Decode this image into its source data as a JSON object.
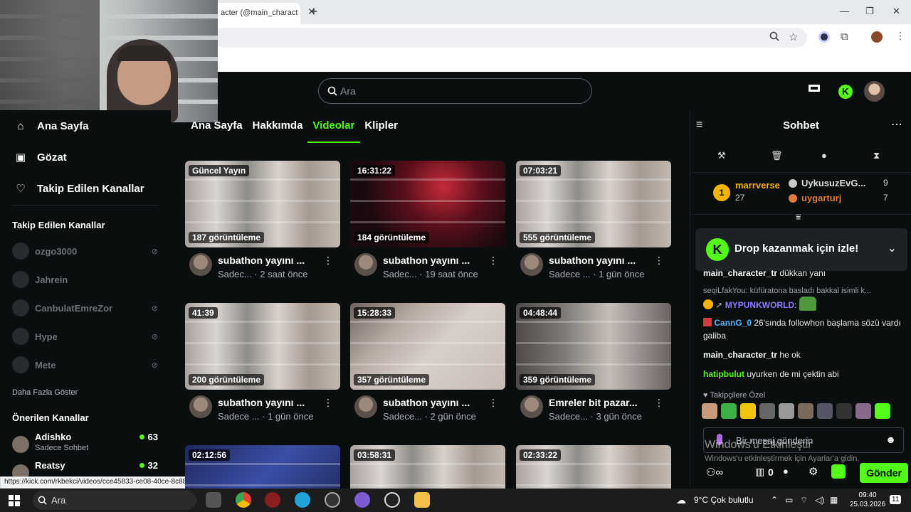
{
  "browser": {
    "tab_title": "acter (@main_charact",
    "status_url": "https://kick.com/rkbekci/videos/cce45833-ce08-40ce-8c88-fb3f95a21946"
  },
  "header": {
    "search_placeholder": "Ara"
  },
  "sidebar": {
    "nav": [
      {
        "label": "Ana Sayfa",
        "icon": "home-icon"
      },
      {
        "label": "Gözat",
        "icon": "browse-icon"
      },
      {
        "label": "Takip Edilen Kanallar",
        "icon": "heart-icon"
      }
    ],
    "followed_title": "Takip Edilen Kanallar",
    "followed": [
      {
        "name": "ozgo3000"
      },
      {
        "name": "Jahrein"
      },
      {
        "name": "CanbulatEmreZor"
      },
      {
        "name": "Hype"
      },
      {
        "name": "Mete"
      }
    ],
    "show_more": "Daha Fazla Göster",
    "recommended_title": "Önerilen Kanallar",
    "recommended": [
      {
        "name": "Adishko",
        "sub": "Sadece Sohbet",
        "viewers": "63"
      },
      {
        "name": "Reatsy",
        "sub": "",
        "viewers": "32"
      }
    ]
  },
  "channel_tabs": [
    "Ana Sayfa",
    "Hakkımda",
    "Videolar",
    "Klipler"
  ],
  "videos": [
    {
      "badge": "Güncel Yayın",
      "views": "187 görüntüleme",
      "title": "subathon yayını ...",
      "sub": "Sadec... · 2 saat önce",
      "style": "thumb-shop"
    },
    {
      "badge": "16:31:22",
      "views": "184 görüntüleme",
      "title": "subathon yayını ...",
      "sub": "Sadec... · 19 saat önce",
      "style": "thumb-dark"
    },
    {
      "badge": "07:03:21",
      "views": "555 görüntüleme",
      "title": "subathon yayını ...",
      "sub": "Sadece ... · 1 gün önce",
      "style": "thumb-shop"
    },
    {
      "badge": "41:39",
      "views": "200 görüntüleme",
      "title": "subathon yayını ...",
      "sub": "Sadece ... · 1 gün önce",
      "style": "thumb-shop"
    },
    {
      "badge": "15:28:33",
      "views": "357 görüntüleme",
      "title": "subathon yayını ...",
      "sub": "Sadece... · 2 gün önce",
      "style": "thumb-wall"
    },
    {
      "badge": "04:48:44",
      "views": "359 görüntüleme",
      "title": "Emreler bit pazar...",
      "sub": "Sadece... · 3 gün önce",
      "style": "thumb-desk"
    },
    {
      "badge": "02:12:56",
      "views": "",
      "title": "",
      "sub": "",
      "style": "thumb-blue"
    },
    {
      "badge": "03:58:31",
      "views": "",
      "title": "",
      "sub": "",
      "style": "thumb-shop"
    },
    {
      "badge": "02:33:22",
      "views": "",
      "title": "",
      "sub": "",
      "style": "thumb-shop"
    }
  ],
  "chat": {
    "title": "Sohbet",
    "leaderboard": {
      "first_name": "marrverse",
      "first_count": "27",
      "second_name": "UykusuzEvG...",
      "second_count": "9",
      "third_name": "uygarturj",
      "third_count": "7"
    },
    "drop_text": "Drop kazanmak için izle!",
    "messages": [
      {
        "user": "main_character_tr",
        "text": " dükkan yanı",
        "color": "#ffffff"
      },
      {
        "reply": "seqiLfakYou: küfüratona basladı bakkal isimli k..."
      },
      {
        "user": "MYPUNKWORLD",
        "text": ":",
        "color": "#8a7dff"
      },
      {
        "user": "CannG_0",
        "text": " 26'sında followhon başlama sözü vardı galiba",
        "color": "#5ab8ff"
      },
      {
        "user": "main_character_tr",
        "text": " he ok",
        "color": "#ffffff"
      },
      {
        "user": "hatipbulut",
        "text": " uyurken de mi çektin abi",
        "color": "#53fc18"
      }
    ],
    "followers_only": "Takipçilere Özel",
    "composer_placeholder": "Bir mesaj gönderin",
    "activate_title": "Windows'u Etkinleştir",
    "activate_sub": "Windows'u etkinleştirmek için Ayarlar'a gidin.",
    "points": "0",
    "send_label": "Gönder"
  },
  "taskbar": {
    "search": "Ara",
    "weather": "9°C  Çok bulutlu",
    "time": "09:40",
    "date": "25.03.2026",
    "notif": "11"
  },
  "colors": {
    "accent": "#53fc18",
    "background": "#0b0e0f"
  }
}
